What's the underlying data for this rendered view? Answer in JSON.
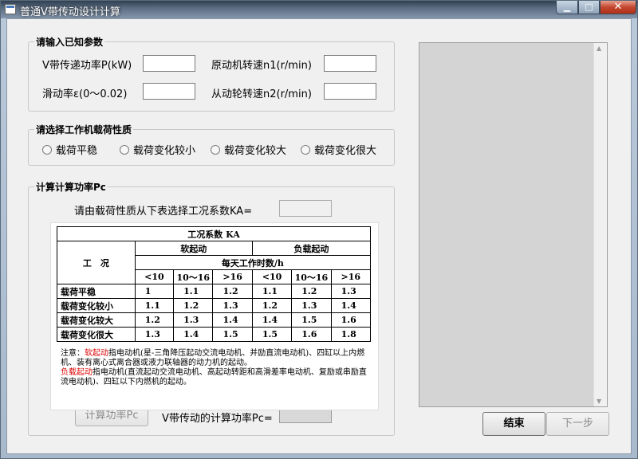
{
  "window": {
    "title": "普通V带传动设计计算",
    "min_glyph": "▁",
    "max_glyph": "□",
    "close_glyph": "✕"
  },
  "known_params": {
    "title": "请输入已知参数",
    "power_label": "V带传递功率P(kW)",
    "speed_n1_label": "原动机转速n1(r/min)",
    "slip_label": "滑动率ε(0～0.02)",
    "speed_n2_label": "从动轮转速n2(r/min)",
    "power_value": "",
    "speed_n1_value": "",
    "slip_value": "",
    "speed_n2_value": ""
  },
  "load_type": {
    "title": "请选择工作机载荷性质",
    "options": [
      "载荷平稳",
      "载荷变化较小",
      "载荷变化较大",
      "载荷变化很大"
    ]
  },
  "calc": {
    "title": "计算计算功率Pc",
    "ka_prompt": "请由载荷性质从下表选择工况系数KA=",
    "ka_value": "",
    "calc_button": "计算功率Pc",
    "result_label": "V带传动的计算功率Pc=",
    "result_value": ""
  },
  "ka_table": {
    "title": "工况系数 KA",
    "col_group_left": "软起动",
    "col_group_right": "负载起动",
    "row_header": "工　况",
    "hours_header": "每天工作时数/h",
    "hours": [
      "<10",
      "10～16",
      ">16",
      "<10",
      "10～16",
      ">16"
    ],
    "rows": [
      {
        "label": "载荷平稳",
        "values": [
          "1",
          "1.1",
          "1.2",
          "1.1",
          "1.2",
          "1.3"
        ]
      },
      {
        "label": "载荷变化较小",
        "values": [
          "1.1",
          "1.2",
          "1.3",
          "1.2",
          "1.3",
          "1.4"
        ]
      },
      {
        "label": "载荷变化较大",
        "values": [
          "1.2",
          "1.3",
          "1.4",
          "1.4",
          "1.5",
          "1.6"
        ]
      },
      {
        "label": "载荷变化很大",
        "values": [
          "1.3",
          "1.4",
          "1.5",
          "1.5",
          "1.6",
          "1.8"
        ]
      }
    ],
    "note": {
      "prefix": "注意：",
      "soft_term": "软起动",
      "soft_text": "指电动机(星-三角降压起动交流电动机、并励直流电动机)、四缸以上内燃机、装有离心式离合器或液力联轴器的动力机的起动。",
      "load_term": "负载起动",
      "load_text": "指电动机(直流起动交流电动机、高起动转距和高滑差率电动机、复励或串励直流电动机)、四缸以下内燃机的起动。"
    }
  },
  "buttons": {
    "end": "结束",
    "next": "下一步"
  },
  "colors": {
    "note_highlight": "#dd0000",
    "result_box": "#d8d8d8"
  }
}
